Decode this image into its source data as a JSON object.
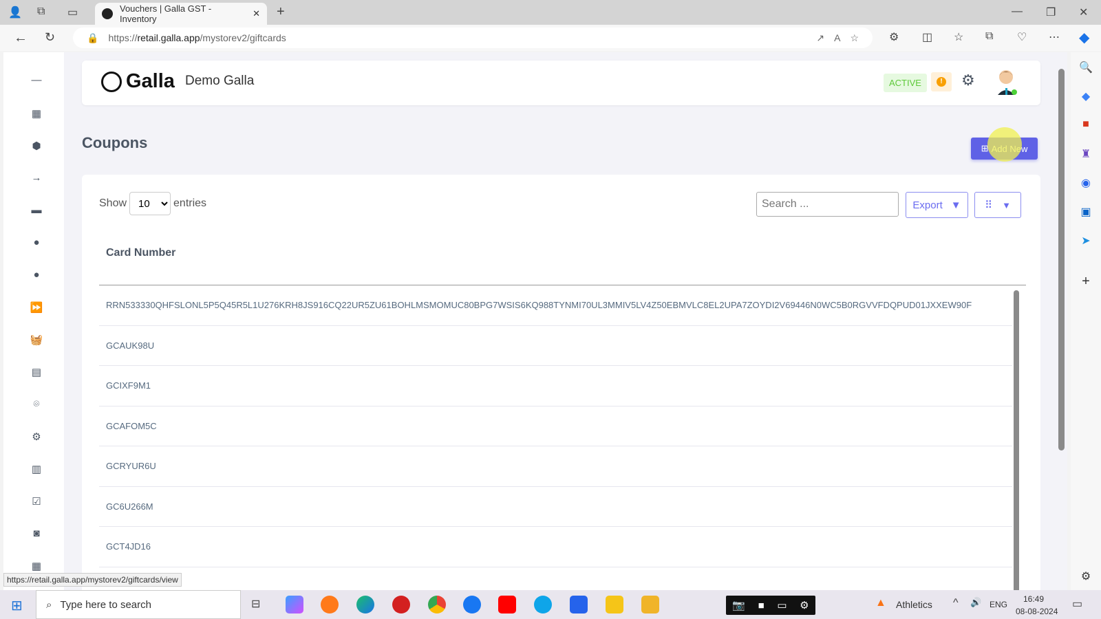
{
  "browser": {
    "tab_title": "Vouchers | Galla GST - Inventory",
    "url_domain": "retail.galla.app",
    "url_prefix": "https://",
    "url_path": "/mystorev2/giftcards",
    "status_url": "https://retail.galla.app/mystorev2/giftcards/view"
  },
  "header": {
    "logo": "Galla",
    "store_name": "Demo Galla",
    "status_badge": "ACTIVE",
    "alert": "!"
  },
  "page": {
    "title": "Coupons",
    "add_new": "Add New"
  },
  "table": {
    "show_label": "Show",
    "entries_label": "entries",
    "page_size": "10",
    "search_placeholder": "Search ...",
    "export_label": "Export",
    "column": "Card Number",
    "rows": [
      "RRN533330QHFSLONL5P5Q45R5L1U276KRH8JS916CQ22UR5ZU61BOHLMSMOMUC80BPG7WSIS6KQ988TYNMI70UL3MMIV5LV4Z50EBMVLC8EL2UPA7ZOYDI2V69446N0WC5B0RGVVFDQPUD01JXXEW90F",
      "GCAUK98U",
      "GCIXF9M1",
      "GCAFOM5C",
      "GCRYUR6U",
      "GC6U266M",
      "GCT4JD16"
    ]
  },
  "taskbar": {
    "search_placeholder": "Type here to search",
    "weather": "Athletics",
    "lang": "ENG",
    "time": "16:49",
    "date": "08-08-2024"
  },
  "colors": {
    "primary": "#5f61e6",
    "active_green": "#5ec93a",
    "warning": "#f9a005"
  }
}
